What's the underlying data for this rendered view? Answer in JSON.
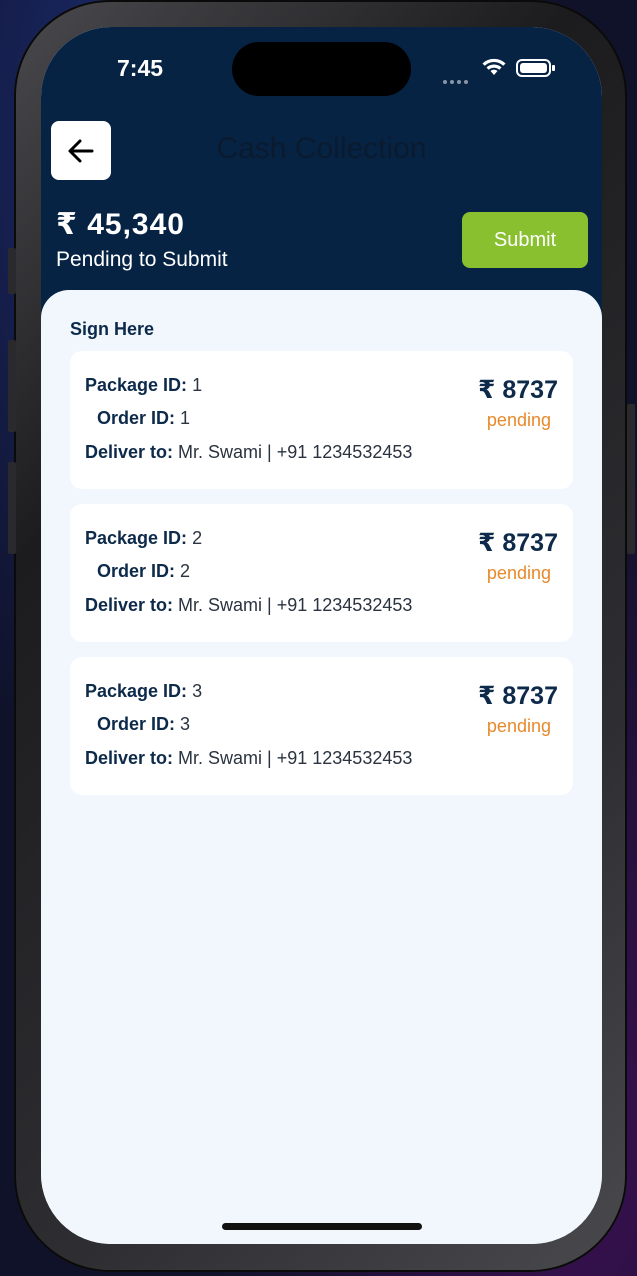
{
  "status_bar": {
    "time": "7:45"
  },
  "header": {
    "back_icon": "arrow-left-icon",
    "title": "Cash Collection",
    "total_amount": "₹ 45,340",
    "total_label": "Pending to Submit",
    "submit_label": "Submit"
  },
  "section": {
    "title": "Sign Here"
  },
  "labels": {
    "package_id": "Package ID:",
    "order_id": "Order ID:",
    "deliver_to": "Deliver to:"
  },
  "packages": [
    {
      "package_id": "1",
      "order_id": "1",
      "deliver_to": "Mr. Swami | +91 1234532453",
      "amount": "₹ 8737",
      "status": "pending"
    },
    {
      "package_id": "2",
      "order_id": "2",
      "deliver_to": "Mr. Swami | +91 1234532453",
      "amount": "₹ 8737",
      "status": "pending"
    },
    {
      "package_id": "3",
      "order_id": "3",
      "deliver_to": "Mr. Swami | +91 1234532453",
      "amount": "₹ 8737",
      "status": "pending"
    }
  ],
  "colors": {
    "header_bg": "#062344",
    "submit_bg": "#88c030",
    "pending": "#e8892a",
    "text_dark": "#0d2a4a",
    "content_bg": "#f1f7fd"
  }
}
